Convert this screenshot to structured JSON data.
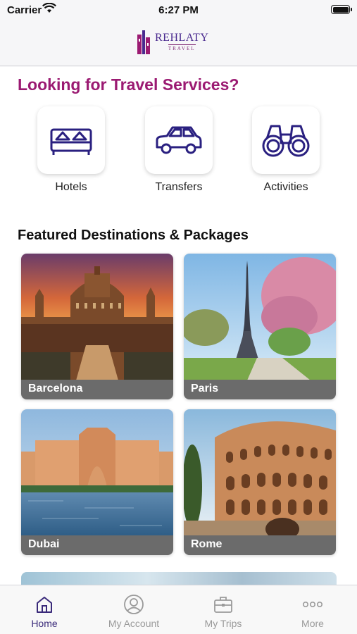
{
  "status_bar": {
    "carrier": "Carrier",
    "time": "6:27 PM"
  },
  "header": {
    "logo_name": "REHLATY",
    "logo_sub": "TRAVEL"
  },
  "services": {
    "heading": "Looking for Travel Services?",
    "items": [
      {
        "label": "Hotels",
        "icon": "bed-icon"
      },
      {
        "label": "Transfers",
        "icon": "car-icon"
      },
      {
        "label": "Activities",
        "icon": "binoculars-icon"
      }
    ]
  },
  "featured": {
    "heading": "Featured Destinations & Packages",
    "items": [
      {
        "label": "Barcelona"
      },
      {
        "label": "Paris"
      },
      {
        "label": "Dubai"
      },
      {
        "label": "Rome"
      }
    ]
  },
  "tabs": [
    {
      "label": "Home",
      "icon": "home-icon",
      "active": true
    },
    {
      "label": "My Account",
      "icon": "account-icon",
      "active": false
    },
    {
      "label": "My Trips",
      "icon": "briefcase-icon",
      "active": false
    },
    {
      "label": "More",
      "icon": "more-icon",
      "active": false
    }
  ],
  "colors": {
    "accent": "#9b1a72",
    "brand": "#4a2a8f",
    "tab_active": "#3a2a7a",
    "tab_inactive": "#9a9a9a"
  }
}
